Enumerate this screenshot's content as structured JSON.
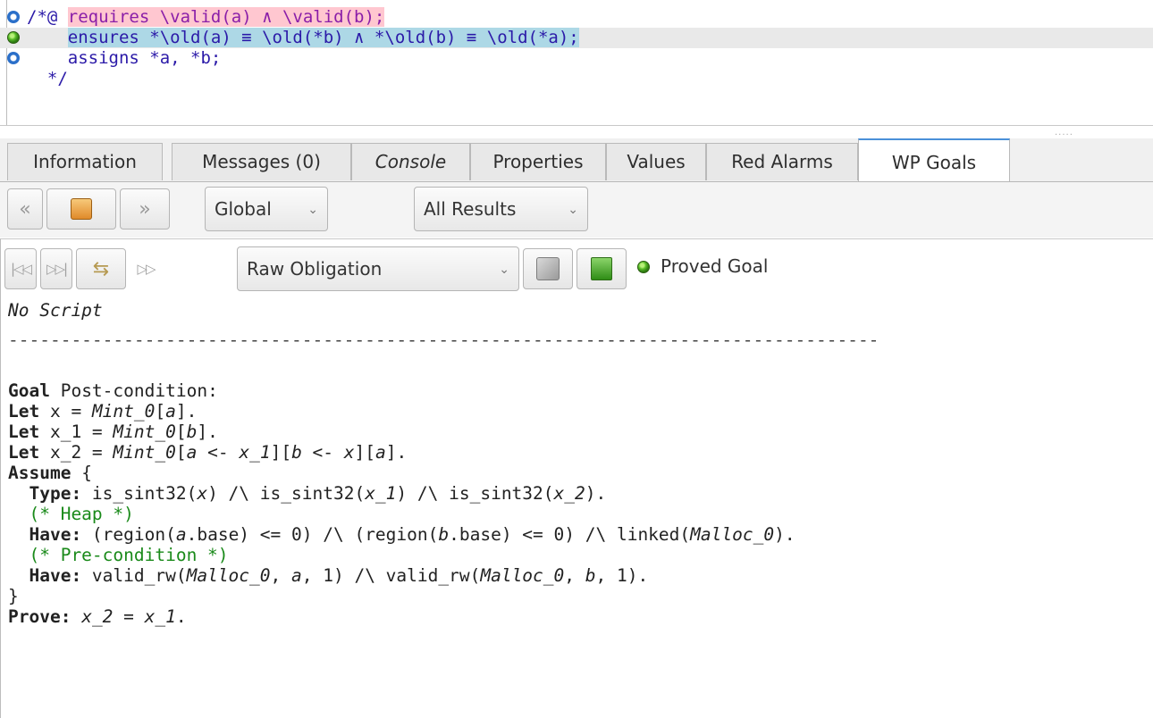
{
  "source": {
    "lines": [
      {
        "marker": "blue-ring",
        "prefix": "/*@ ",
        "code": "requires \\valid(a) ∧ \\valid(b);",
        "highlight": "pink"
      },
      {
        "marker": "green",
        "prefix": "    ",
        "code": "ensures *\\old(a) ≡ \\old(*b) ∧ *\\old(b) ≡ \\old(*a);",
        "highlight": "blue"
      },
      {
        "marker": "blue-ring",
        "prefix": "    ",
        "code": "assigns *a, *b;",
        "highlight": "none"
      },
      {
        "marker": "none",
        "prefix": "  ",
        "code": "*/",
        "highlight": "none"
      }
    ],
    "grip": "·····"
  },
  "tabs": [
    {
      "label": "Information",
      "italic": false,
      "active": false
    },
    {
      "label": "Messages (0)",
      "italic": false,
      "active": false
    },
    {
      "label": "Console",
      "italic": true,
      "active": false
    },
    {
      "label": "Properties",
      "italic": false,
      "active": false
    },
    {
      "label": "Values",
      "italic": false,
      "active": false
    },
    {
      "label": "Red Alarms",
      "italic": false,
      "active": false
    },
    {
      "label": "WP Goals",
      "italic": false,
      "active": true
    }
  ],
  "toolbar": {
    "scope_select": "Global",
    "results_select": "All Results"
  },
  "goal_toolbar": {
    "view_select": "Raw Obligation",
    "status_text": "Proved Goal",
    "status_color": "#3cae1e"
  },
  "goal": {
    "script_label": "No Script",
    "separator": "-----------------------------------------------------------------------------------",
    "lines": [
      "",
      "Goal Post-condition:",
      "Let x = Mint_0[a].",
      "Let x_1 = Mint_0[b].",
      "Let x_2 = Mint_0[a <- x_1][b <- x][a].",
      "Assume {",
      "  Type: is_sint32(x) /\\ is_sint32(x_1) /\\ is_sint32(x_2).",
      "  (* Heap *)",
      "  Have: (region(a.base) <= 0) /\\ (region(b.base) <= 0) /\\ linked(Malloc_0).",
      "  (* Pre-condition *)",
      "  Have: valid_rw(Malloc_0, a, 1) /\\ valid_rw(Malloc_0, b, 1).",
      "}",
      "Prove: x_2 = x_1."
    ]
  }
}
